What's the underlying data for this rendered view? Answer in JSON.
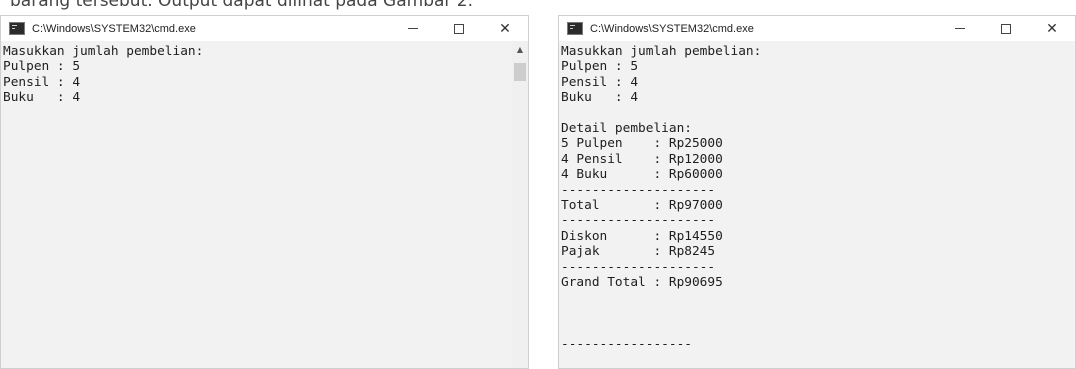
{
  "caption": "barang tersebut. Output dapat dilihat pada Gambar 2.",
  "left_window": {
    "title": "C:\\Windows\\SYSTEM32\\cmd.exe",
    "controls": {
      "minimize": "—",
      "maximize": "☐",
      "close": "✕"
    },
    "scroll_up": "▲",
    "lines": [
      "Masukkan jumlah pembelian:",
      "Pulpen : 5",
      "Pensil : 4",
      "Buku   : 4"
    ]
  },
  "right_window": {
    "title": "C:\\Windows\\SYSTEM32\\cmd.exe",
    "controls": {
      "minimize": "—",
      "maximize": "☐",
      "close": "✕"
    },
    "lines": [
      "Masukkan jumlah pembelian:",
      "Pulpen : 5",
      "Pensil : 4",
      "Buku   : 4",
      "",
      "Detail pembelian:",
      "5 Pulpen    : Rp25000",
      "4 Pensil    : Rp12000",
      "4 Buku      : Rp60000",
      "--------------------",
      "Total       : Rp97000",
      "--------------------",
      "Diskon      : Rp14550",
      "Pajak       : Rp8245",
      "--------------------",
      "Grand Total : Rp90695",
      "",
      "",
      "",
      "-----------------"
    ]
  }
}
